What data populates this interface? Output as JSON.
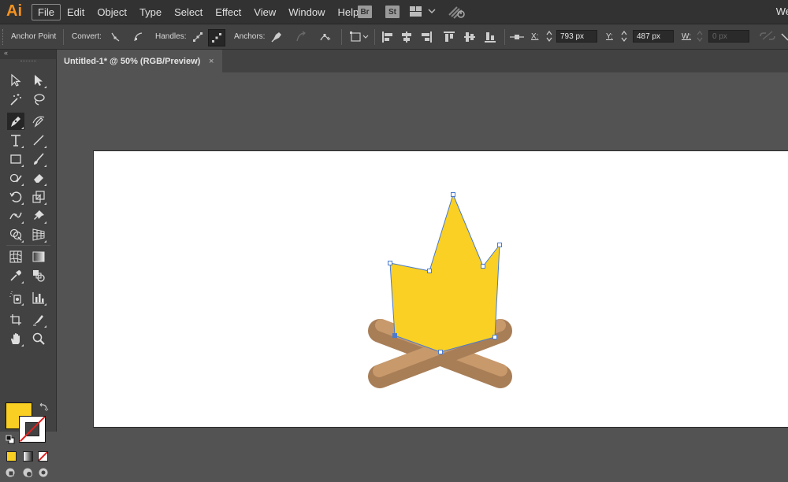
{
  "app": {
    "logo": "Ai",
    "workspace": "We"
  },
  "menu": [
    "File",
    "Edit",
    "Object",
    "Type",
    "Select",
    "Effect",
    "View",
    "Window",
    "Help"
  ],
  "app_buttons": {
    "bridge": "Br",
    "stock": "St"
  },
  "control_bar": {
    "tool_label": "Anchor Point",
    "convert_label": "Convert:",
    "handles_label": "Handles:",
    "anchors_label": "Anchors:",
    "x_label": "X:",
    "x_value": "793 px",
    "y_label": "Y:",
    "y_value": "487 px",
    "w_label": "W:",
    "w_value": "0 px"
  },
  "document": {
    "tab_title": "Untitled-1* @ 50% (RGB/Preview)",
    "close": "×"
  },
  "colors": {
    "fill": "#f9cf23",
    "stroke": "none",
    "artboard": "#ffffff",
    "log_light": "#c8996b",
    "log_dark": "#a87e57",
    "flame": "#f9d023",
    "selection": "#4a7bd0"
  },
  "tools": [
    "selection-tool",
    "direct-selection-tool",
    "magic-wand-tool",
    "lasso-tool",
    "pen-tool",
    "curvature-tool",
    "type-tool",
    "line-segment-tool",
    "rectangle-tool",
    "paintbrush-tool",
    "shaper-tool",
    "eraser-tool",
    "rotate-tool",
    "scale-tool",
    "width-tool",
    "puppet-warp-tool",
    "shape-builder-tool",
    "perspective-grid-tool",
    "mesh-tool",
    "gradient-tool",
    "eyedropper-tool",
    "blend-tool",
    "symbol-sprayer-tool",
    "column-graph-tool",
    "artboard-tool",
    "slice-tool",
    "hand-tool",
    "zoom-tool"
  ]
}
